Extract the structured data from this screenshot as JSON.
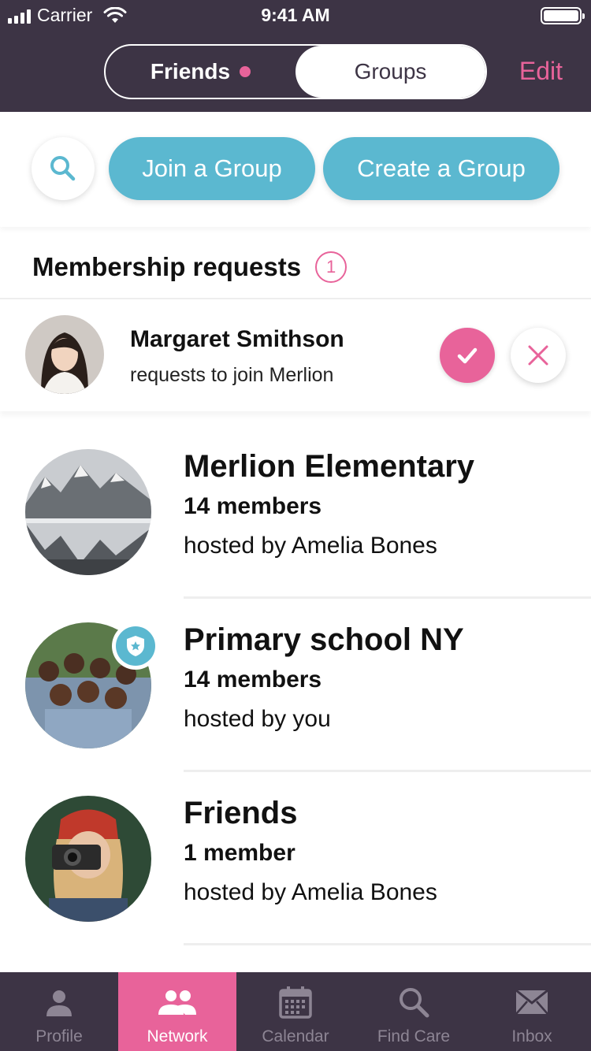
{
  "status_bar": {
    "carrier": "Carrier",
    "time": "9:41 AM"
  },
  "header": {
    "segments": [
      {
        "label": "Friends"
      },
      {
        "label": "Groups"
      }
    ],
    "selected_segment": "Groups",
    "edit_label": "Edit"
  },
  "actions": {
    "join_label": "Join a Group",
    "create_label": "Create a Group"
  },
  "requests": {
    "title": "Membership requests",
    "count": "1",
    "items": [
      {
        "name": "Margaret Smithson",
        "subtitle": "requests to join Merlion"
      }
    ]
  },
  "groups": [
    {
      "title": "Merlion Elementary",
      "members": "14 members",
      "host": "hosted by Amelia Bones"
    },
    {
      "title": "Primary school NY",
      "members": "14 members",
      "host": "hosted by you",
      "admin": true
    },
    {
      "title": "Friends",
      "members": "1 member",
      "host": "hosted by Amelia Bones"
    }
  ],
  "tabbar": {
    "items": [
      {
        "label": "Profile",
        "icon": "person-icon"
      },
      {
        "label": "Network",
        "icon": "people-icon"
      },
      {
        "label": "Calendar",
        "icon": "calendar-icon"
      },
      {
        "label": "Find Care",
        "icon": "search-icon"
      },
      {
        "label": "Inbox",
        "icon": "mail-icon"
      }
    ],
    "active": "Network"
  },
  "colors": {
    "header_bg": "#3d3445",
    "accent_pink": "#e8639a",
    "accent_teal": "#5bb8d0"
  }
}
